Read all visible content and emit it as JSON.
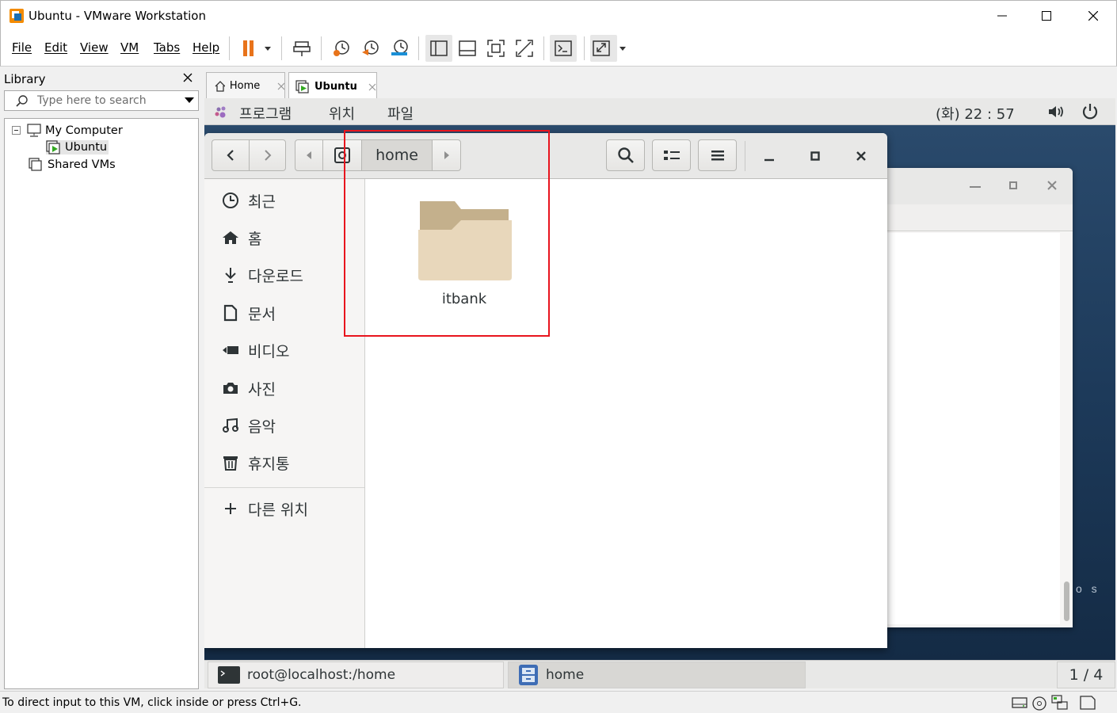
{
  "window": {
    "title": "Ubuntu - VMware Workstation"
  },
  "menu": {
    "file": "File",
    "edit": "Edit",
    "view": "View",
    "vm": "VM",
    "tabs": "Tabs",
    "help": "Help"
  },
  "library": {
    "title": "Library",
    "search_placeholder": "Type here to search",
    "tree": {
      "my_computer": "My Computer",
      "ubuntu": "Ubuntu",
      "shared_vms": "Shared VMs"
    }
  },
  "tabs": [
    {
      "label": "Home"
    },
    {
      "label": "Ubuntu"
    }
  ],
  "guest": {
    "topbar": {
      "programs": "프로그램",
      "places": "위치",
      "file": "파일",
      "clock": "(화) 22 : 57"
    },
    "nautilus": {
      "path": "home",
      "sidebar": {
        "recent": "최근",
        "home": "홈",
        "downloads": "다운로드",
        "documents": "문서",
        "videos": "비디오",
        "pictures": "사진",
        "music": "음악",
        "trash": "휴지통",
        "other": "다른 위치"
      },
      "items": [
        {
          "name": "itbank"
        }
      ]
    },
    "bg_text": "o s",
    "windowlist": {
      "terminal": "root@localhost:/home",
      "files": "home",
      "workspace": "1 / 4"
    }
  },
  "statusbar": {
    "message": "To direct input to this VM, click inside or press Ctrl+G."
  },
  "colors": {
    "highlight": "#e8141d",
    "pause_orange": "#e8731a",
    "folder_tan": "#e8d7bb"
  }
}
